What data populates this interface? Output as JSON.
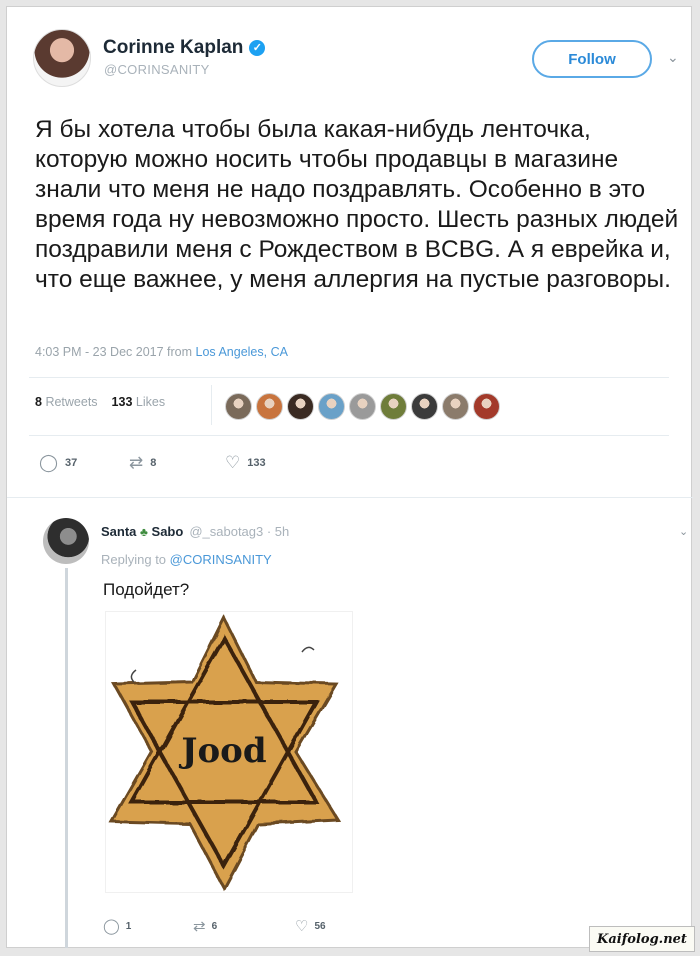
{
  "tweet": {
    "author_name": "Corinne Kaplan",
    "author_handle": "@CORINSANITY",
    "follow_label": "Follow",
    "text": "Я бы хотела чтобы была какая-нибудь ленточка, которую можно носить чтобы продавцы в магазине знали что меня не надо поздравлять. Особенно в это время года ну невозможно просто. Шесть разных людей поздравили меня с Рождеством в BCBG. А я еврейка и, что еще важнее, у меня аллергия на пустые разговоры.",
    "timestamp": "4:03 PM - 23 Dec 2017 from",
    "location": "Los Angeles, CA",
    "retweets_count": "8",
    "retweets_label": "Retweets",
    "likes_count": "133",
    "likes_label": "Likes",
    "liker_colors": [
      "#7a6a5a",
      "#c8743e",
      "#3a2a22",
      "#6aa1c8",
      "#9a9a9a",
      "#6f7d3a",
      "#3b3b3b",
      "#8b7b6b",
      "#a33a2a"
    ],
    "actions": {
      "reply_count": "37",
      "retweet_count": "8",
      "like_count": "133"
    }
  },
  "reply": {
    "author_name": "Santa",
    "author_name_suffix": "Sabo",
    "author_handle": "@_sabotag3 · 5h",
    "replying_prefix": "Replying to",
    "replying_handle": "@CORINSANITY",
    "text": "Подойдет?",
    "image_text": "Jood",
    "actions": {
      "reply_count": "1",
      "retweet_count": "6",
      "like_count": "56"
    }
  },
  "watermark": "Kaifolog.net",
  "colors": {
    "accent": "#1da1f2",
    "star_fill": "#d9a14e",
    "star_edge": "#6a4a22"
  }
}
